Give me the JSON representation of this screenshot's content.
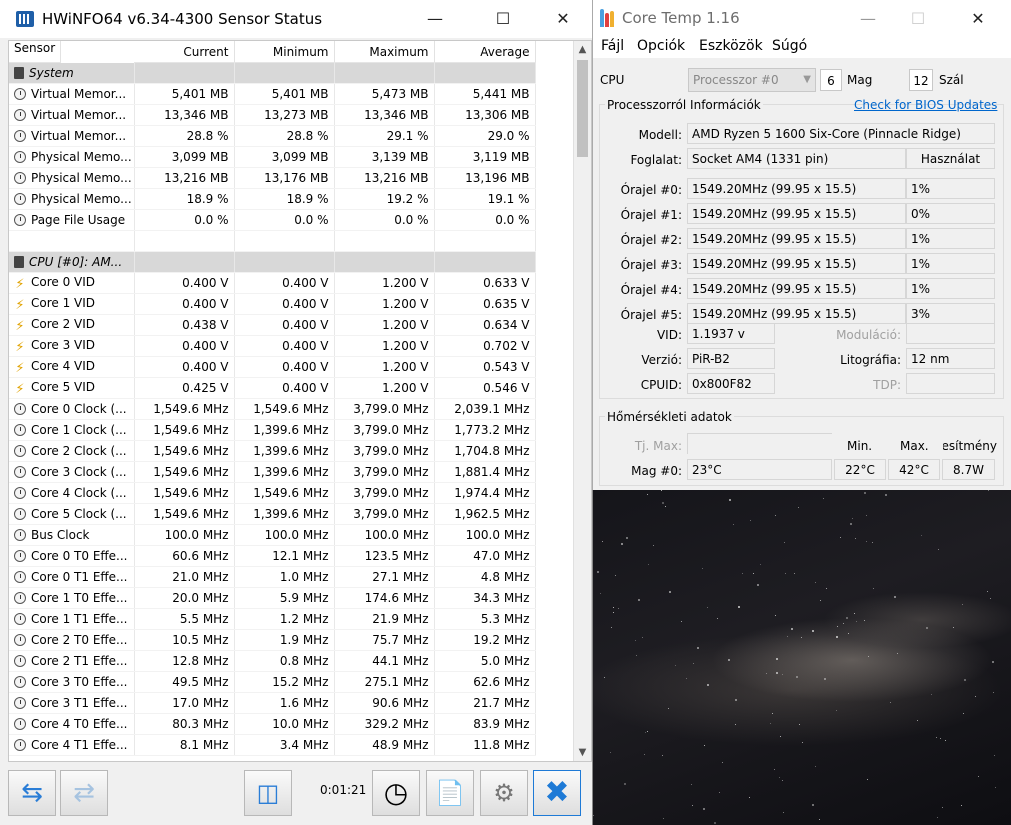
{
  "hwinfo": {
    "title": "HWiNFO64 v6.34-4300 Sensor Status",
    "columns": [
      "Sensor",
      "Current",
      "Minimum",
      "Maximum",
      "Average"
    ],
    "rows": [
      {
        "type": "group",
        "name": "System",
        "icon": "chip-icon"
      },
      {
        "type": "row",
        "icon": "gauge-icon",
        "name": "Virtual Memor...",
        "cur": "5,401 MB",
        "min": "5,401 MB",
        "max": "5,473 MB",
        "avg": "5,441 MB"
      },
      {
        "type": "row",
        "icon": "gauge-icon",
        "name": "Virtual Memor...",
        "cur": "13,346 MB",
        "min": "13,273 MB",
        "max": "13,346 MB",
        "avg": "13,306 MB"
      },
      {
        "type": "row",
        "icon": "gauge-icon",
        "name": "Virtual Memor...",
        "cur": "28.8 %",
        "min": "28.8 %",
        "max": "29.1 %",
        "avg": "29.0 %"
      },
      {
        "type": "row",
        "icon": "gauge-icon",
        "name": "Physical Memo...",
        "cur": "3,099 MB",
        "min": "3,099 MB",
        "max": "3,139 MB",
        "avg": "3,119 MB"
      },
      {
        "type": "row",
        "icon": "gauge-icon",
        "name": "Physical Memo...",
        "cur": "13,216 MB",
        "min": "13,176 MB",
        "max": "13,216 MB",
        "avg": "13,196 MB"
      },
      {
        "type": "row",
        "icon": "gauge-icon",
        "name": "Physical Memo...",
        "cur": "18.9 %",
        "min": "18.9 %",
        "max": "19.2 %",
        "avg": "19.1 %"
      },
      {
        "type": "row",
        "icon": "gauge-icon",
        "name": "Page File Usage",
        "cur": "0.0 %",
        "min": "0.0 %",
        "max": "0.0 %",
        "avg": "0.0 %"
      },
      {
        "type": "empty"
      },
      {
        "type": "group",
        "name": "CPU [#0]: AM...",
        "icon": "chip-icon"
      },
      {
        "type": "row",
        "icon": "voltage-icon",
        "name": "Core 0 VID",
        "cur": "0.400 V",
        "min": "0.400 V",
        "max": "1.200 V",
        "avg": "0.633 V"
      },
      {
        "type": "row",
        "icon": "voltage-icon",
        "name": "Core 1 VID",
        "cur": "0.400 V",
        "min": "0.400 V",
        "max": "1.200 V",
        "avg": "0.635 V"
      },
      {
        "type": "row",
        "icon": "voltage-icon",
        "name": "Core 2 VID",
        "cur": "0.438 V",
        "min": "0.400 V",
        "max": "1.200 V",
        "avg": "0.634 V"
      },
      {
        "type": "row",
        "icon": "voltage-icon",
        "name": "Core 3 VID",
        "cur": "0.400 V",
        "min": "0.400 V",
        "max": "1.200 V",
        "avg": "0.702 V"
      },
      {
        "type": "row",
        "icon": "voltage-icon",
        "name": "Core 4 VID",
        "cur": "0.400 V",
        "min": "0.400 V",
        "max": "1.200 V",
        "avg": "0.543 V"
      },
      {
        "type": "row",
        "icon": "voltage-icon",
        "name": "Core 5 VID",
        "cur": "0.425 V",
        "min": "0.400 V",
        "max": "1.200 V",
        "avg": "0.546 V"
      },
      {
        "type": "row",
        "icon": "gauge-icon",
        "name": "Core 0 Clock (...",
        "cur": "1,549.6 MHz",
        "min": "1,549.6 MHz",
        "max": "3,799.0 MHz",
        "avg": "2,039.1 MHz"
      },
      {
        "type": "row",
        "icon": "gauge-icon",
        "name": "Core 1 Clock (...",
        "cur": "1,549.6 MHz",
        "min": "1,399.6 MHz",
        "max": "3,799.0 MHz",
        "avg": "1,773.2 MHz"
      },
      {
        "type": "row",
        "icon": "gauge-icon",
        "name": "Core 2 Clock (...",
        "cur": "1,549.6 MHz",
        "min": "1,399.6 MHz",
        "max": "3,799.0 MHz",
        "avg": "1,704.8 MHz"
      },
      {
        "type": "row",
        "icon": "gauge-icon",
        "name": "Core 3 Clock (...",
        "cur": "1,549.6 MHz",
        "min": "1,399.6 MHz",
        "max": "3,799.0 MHz",
        "avg": "1,881.4 MHz"
      },
      {
        "type": "row",
        "icon": "gauge-icon",
        "name": "Core 4 Clock (...",
        "cur": "1,549.6 MHz",
        "min": "1,549.6 MHz",
        "max": "3,799.0 MHz",
        "avg": "1,974.4 MHz"
      },
      {
        "type": "row",
        "icon": "gauge-icon",
        "name": "Core 5 Clock (...",
        "cur": "1,549.6 MHz",
        "min": "1,399.6 MHz",
        "max": "3,799.0 MHz",
        "avg": "1,962.5 MHz"
      },
      {
        "type": "row",
        "icon": "gauge-icon",
        "name": "Bus Clock",
        "cur": "100.0 MHz",
        "min": "100.0 MHz",
        "max": "100.0 MHz",
        "avg": "100.0 MHz"
      },
      {
        "type": "row",
        "icon": "gauge-icon",
        "name": "Core 0 T0 Effe...",
        "cur": "60.6 MHz",
        "min": "12.1 MHz",
        "max": "123.5 MHz",
        "avg": "47.0 MHz"
      },
      {
        "type": "row",
        "icon": "gauge-icon",
        "name": "Core 0 T1 Effe...",
        "cur": "21.0 MHz",
        "min": "1.0 MHz",
        "max": "27.1 MHz",
        "avg": "4.8 MHz"
      },
      {
        "type": "row",
        "icon": "gauge-icon",
        "name": "Core 1 T0 Effe...",
        "cur": "20.0 MHz",
        "min": "5.9 MHz",
        "max": "174.6 MHz",
        "avg": "34.3 MHz"
      },
      {
        "type": "row",
        "icon": "gauge-icon",
        "name": "Core 1 T1 Effe...",
        "cur": "5.5 MHz",
        "min": "1.2 MHz",
        "max": "21.9 MHz",
        "avg": "5.3 MHz"
      },
      {
        "type": "row",
        "icon": "gauge-icon",
        "name": "Core 2 T0 Effe...",
        "cur": "10.5 MHz",
        "min": "1.9 MHz",
        "max": "75.7 MHz",
        "avg": "19.2 MHz"
      },
      {
        "type": "row",
        "icon": "gauge-icon",
        "name": "Core 2 T1 Effe...",
        "cur": "12.8 MHz",
        "min": "0.8 MHz",
        "max": "44.1 MHz",
        "avg": "5.0 MHz"
      },
      {
        "type": "row",
        "icon": "gauge-icon",
        "name": "Core 3 T0 Effe...",
        "cur": "49.5 MHz",
        "min": "15.2 MHz",
        "max": "275.1 MHz",
        "avg": "62.6 MHz"
      },
      {
        "type": "row",
        "icon": "gauge-icon",
        "name": "Core 3 T1 Effe...",
        "cur": "17.0 MHz",
        "min": "1.6 MHz",
        "max": "90.6 MHz",
        "avg": "21.7 MHz"
      },
      {
        "type": "row",
        "icon": "gauge-icon",
        "name": "Core 4 T0 Effe...",
        "cur": "80.3 MHz",
        "min": "10.0 MHz",
        "max": "329.2 MHz",
        "avg": "83.9 MHz"
      },
      {
        "type": "row",
        "icon": "gauge-icon",
        "name": "Core 4 T1 Effe...",
        "cur": "8.1 MHz",
        "min": "3.4 MHz",
        "max": "48.9 MHz",
        "avg": "11.8 MHz"
      }
    ],
    "elapsed_time": "0:01:21"
  },
  "coretemp": {
    "title": "Core Temp 1.16",
    "menu": [
      "Fájl",
      "Opciók",
      "Eszközök",
      "Súgó"
    ],
    "cpu_label": "CPU",
    "processor_select": "Processzor #0",
    "cores": "6",
    "cores_label": "Mag",
    "threads": "12",
    "threads_label": "Szál",
    "info_group_title": "Processzorról Információk",
    "bios_link": "Check for BIOS Updates",
    "model_label": "Modell:",
    "model": "AMD Ryzen 5 1600 Six-Core (Pinnacle Ridge)",
    "socket_label": "Foglalat:",
    "socket": "Socket AM4 (1331 pin)",
    "usage_header": "Használat",
    "clocks": [
      {
        "label": "Órajel #0:",
        "value": "1549.20MHz (99.95 x 15.5)",
        "usage": "1%"
      },
      {
        "label": "Órajel #1:",
        "value": "1549.20MHz (99.95 x 15.5)",
        "usage": "0%"
      },
      {
        "label": "Órajel #2:",
        "value": "1549.20MHz (99.95 x 15.5)",
        "usage": "1%"
      },
      {
        "label": "Órajel #3:",
        "value": "1549.20MHz (99.95 x 15.5)",
        "usage": "1%"
      },
      {
        "label": "Órajel #4:",
        "value": "1549.20MHz (99.95 x 15.5)",
        "usage": "1%"
      },
      {
        "label": "Órajel #5:",
        "value": "1549.20MHz (99.95 x 15.5)",
        "usage": "3%"
      }
    ],
    "vid_label": "VID:",
    "vid": "1.1937 v",
    "modulation_label": "Moduláció:",
    "version_label": "Verzió:",
    "version": "PiR-B2",
    "litho_label": "Litográfia:",
    "litho": "12 nm",
    "cpuid_label": "CPUID:",
    "cpuid": "0x800F82",
    "tdp_label": "TDP:",
    "temp_group_title": "Hőmérsékleti adatok",
    "tjmax_label": "Tj. Max:",
    "min_header": "Min.",
    "max_header": "Max.",
    "power_header": "Teljesítmény",
    "core_label": "Mag #0:",
    "core_temp": "23°C",
    "core_min": "22°C",
    "core_max": "42°C",
    "core_power": "8.7W"
  }
}
